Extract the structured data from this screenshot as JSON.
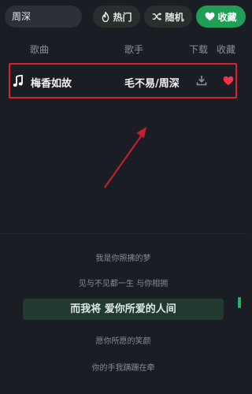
{
  "search": {
    "value": "周深"
  },
  "toolbar": {
    "hot_label": "热门",
    "hot_icon": "flame-icon",
    "random_label": "随机",
    "random_icon": "shuffle-icon",
    "favorites_label": "收藏",
    "favorites_icon": "heart-icon"
  },
  "table": {
    "columns": {
      "song": "歌曲",
      "artist": "歌手",
      "download": "下载",
      "favorite": "收藏"
    },
    "rows": [
      {
        "icon": "music-note-icon",
        "title": "梅香如故",
        "artist": "毛不易/周深",
        "download_icon": "download-icon",
        "favorite_icon": "heart-icon",
        "favorited": true
      }
    ]
  },
  "lyrics": {
    "lines": [
      "我是你照拂的梦",
      "见与不见都一生 与你相拥",
      "而我将 爱你所爱的人间",
      "愿你所愿的笑颜",
      "你的手我蹒跚在牵"
    ],
    "current_index": 2
  },
  "colors": {
    "background": "#1b1d24",
    "accent_green": "#1f9e55",
    "highlight_red": "#d8232f",
    "heart_red": "#f0334b"
  }
}
